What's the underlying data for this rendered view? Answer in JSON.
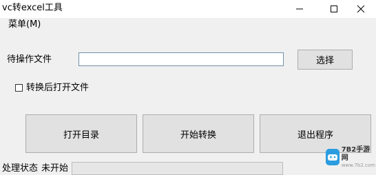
{
  "window": {
    "title": "vc转excel工具",
    "controls": {
      "minimize_icon": "minimize-icon",
      "maximize_icon": "maximize-icon",
      "close_icon": "close-icon"
    }
  },
  "menu": {
    "items": [
      {
        "label": "菜单(M)"
      }
    ]
  },
  "form": {
    "file_label": "待操作文件",
    "file_value": "",
    "select_button": "选择",
    "checkbox_label": "转换后打开文件",
    "checkbox_checked": false
  },
  "actions": {
    "open_dir": "打开目录",
    "start": "开始转换",
    "exit": "退出程序"
  },
  "status": {
    "label": "处理状态",
    "value": "未开始",
    "progress": 0
  },
  "watermark": {
    "main": "7B2手游网",
    "sub": "www.7b2.com"
  },
  "colors": {
    "accent": "#2c9ce0",
    "input_border": "#6f8fa8",
    "button_bg": "#e1e1e1"
  }
}
